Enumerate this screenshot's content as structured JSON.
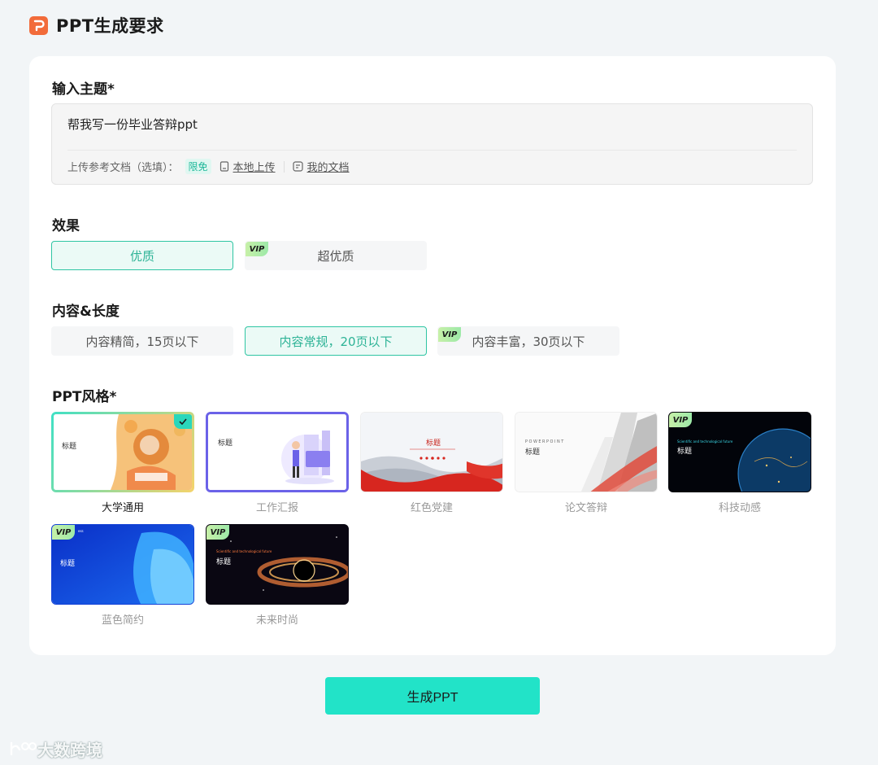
{
  "header": {
    "title": "PPT生成要求"
  },
  "topic": {
    "label": "输入主题*",
    "value": "帮我写一份毕业答辩ppt",
    "upload_label": "上传参考文档（选填）：",
    "free_tag": "限免",
    "local_upload": "本地上传",
    "my_docs": "我的文档"
  },
  "effect": {
    "label": "效果",
    "options": [
      {
        "label": "优质",
        "selected": true,
        "vip": false
      },
      {
        "label": "超优质",
        "selected": false,
        "vip": true
      }
    ]
  },
  "length": {
    "label": "内容&长度",
    "options": [
      {
        "label": "内容精简，15页以下",
        "selected": false,
        "vip": false
      },
      {
        "label": "内容常规，20页以下",
        "selected": true,
        "vip": false
      },
      {
        "label": "内容丰富，30页以下",
        "selected": false,
        "vip": true
      }
    ]
  },
  "styles": {
    "label": "PPT风格*",
    "vip_text": "VIP",
    "items": [
      {
        "label": "大学通用",
        "selected": true,
        "vip": false,
        "thumb_title": "标题"
      },
      {
        "label": "工作汇报",
        "selected": false,
        "vip": false,
        "thumb_title": "标题"
      },
      {
        "label": "红色党建",
        "selected": false,
        "vip": false,
        "thumb_title": "标题"
      },
      {
        "label": "论文答辩",
        "selected": false,
        "vip": false,
        "thumb_title": "标题",
        "thumb_sub": "POWERPOINT"
      },
      {
        "label": "科技动感",
        "selected": false,
        "vip": true,
        "thumb_title": "标题",
        "thumb_sub": "Scientific and technological future"
      },
      {
        "label": "蓝色简约",
        "selected": false,
        "vip": true,
        "thumb_title": "标题",
        "thumb_sub": "ess"
      },
      {
        "label": "未来时尚",
        "selected": false,
        "vip": true,
        "thumb_title": "标题",
        "thumb_sub": "Scientific and technological future"
      }
    ]
  },
  "actions": {
    "generate": "生成PPT"
  },
  "watermark": "大数跨境",
  "colors": {
    "accent": "#22e3c8",
    "selected_border": "#2fc5a3",
    "logo": "#f26b3a"
  }
}
